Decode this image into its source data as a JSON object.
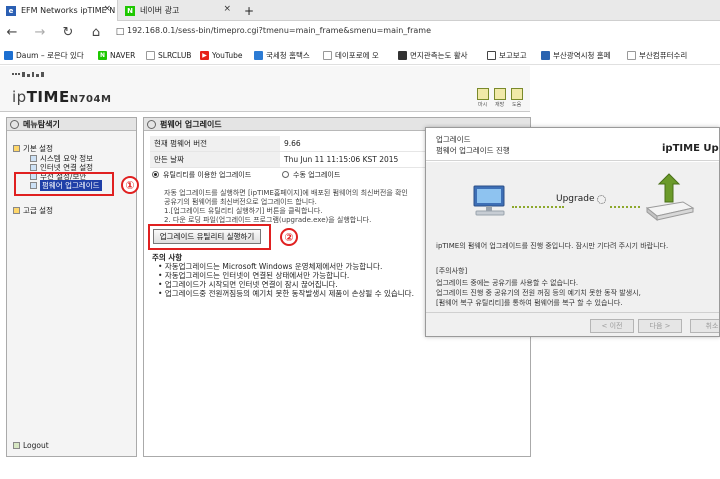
{
  "tabs": [
    {
      "title": "EFM Networks ipTIME N",
      "active": true
    },
    {
      "title": "네이버 광고",
      "active": false
    }
  ],
  "new_tab_glyph": "+",
  "address_bar": {
    "url": "192.168.0.1/sess-bin/timepro.cgi?tmenu=main_frame&smenu=main_frame"
  },
  "favorites": [
    {
      "label": "Daum – 로은다 있다",
      "icon": "daum-icon",
      "color": "#1c6fd1"
    },
    {
      "label": "NAVER",
      "icon": "naver-icon",
      "color": "#1ec800"
    },
    {
      "label": "SLRCLUB",
      "icon": "page-icon",
      "color": "#888888"
    },
    {
      "label": "YouTube",
      "icon": "youtube-icon",
      "color": "#e62117"
    },
    {
      "label": "국세청 홈택스",
      "icon": "hometax-icon",
      "color": "#2c7bd4"
    },
    {
      "label": "데이포로에 오",
      "icon": "page-icon",
      "color": "#888888"
    },
    {
      "label": "면지관측는도 활사",
      "icon": "gov-icon",
      "color": "#333333"
    },
    {
      "label": "보고보고",
      "icon": "page-icon",
      "color": "#444444"
    },
    {
      "label": "부산광역시청 홈페",
      "icon": "busan-icon",
      "color": "#2a63b0"
    },
    {
      "label": "부산컴퓨터수리",
      "icon": "page-icon",
      "color": "#888888"
    }
  ],
  "router": {
    "logo_prefix": "ip",
    "logo_brand": "TIME",
    "model": "N704M",
    "header_icons": [
      "마시",
      "재방",
      "도움"
    ],
    "left_title": "메뉴탐색기",
    "nav": {
      "basic": "기본 설정",
      "system_summary": "시스템 요약 정보",
      "internet": "인터넷 연결 설정",
      "wireless": "무선 설정/보안",
      "firmware": "펌웨어 업그레이드",
      "advanced": "고급 설정"
    },
    "logout": "Logout",
    "main_title": "펌웨어 업그레이드",
    "info": [
      {
        "k": "현재 펌웨어 버전",
        "v": "9.66"
      },
      {
        "k": "만든 날짜",
        "v": "Thu Jun 11 11:15:06 KST 2015"
      }
    ],
    "mode_auto": "유틸리티를 이용한 업그레이드",
    "mode_manual": "수동 업그레이드",
    "desc1": "자동 업그레이드를 실행하면 [ipTIME홈페이지]에 배포된 펌웨어의 최신버전을 확인",
    "desc2": "공유기의 펌웨어를 최신버전으로 업그레이드 합니다.",
    "desc3": "1.[업그레이드 유틸리티 실행하기] 버튼을 클릭합니다.",
    "desc4": "2. 다운 로딩 파일(업그레이드 프로그램(upgrade.exe)을 실행합니다.",
    "run_button": "업그레이드 유틸리티 실행하기",
    "notes_title": "주의 사항",
    "notes": [
      "자동업그레이드는 Microsoft Windows 운영체제에서만 가능합니다.",
      "자동업그레이드는 인터넷이 연결된 상태에서만 가능합니다.",
      "업그레이드가 시작되면 인터넷 연결이 잠시 끊어집니다.",
      "업그레이드중 전원꺼짐등의 예기치 못한 동작발생시 제품이 손상될 수 있습니다."
    ]
  },
  "markers": [
    "①",
    "②"
  ],
  "dialog": {
    "title": "업그레이드",
    "subtitle": "펌웨어 업그레이드 진행",
    "brand": "ipTIME Upg",
    "upgrade_label": "Upgrade",
    "status": "ipTIME의 펌웨어 업그레이드를 진행 중입니다. 잠시만 기다려 주시기 바랍니다.",
    "notice_title": "[주의사항]",
    "notice1": "업그레이드 중에는 공유기를 사용할 수 없습니다.",
    "notice2": "업그레이드 진행 중 공유기의 전원 꺼짐 등의 예기치 못한 동작 발생시,",
    "notice3": "[펌웨어 복구 유틸리티]를 통하여 펌웨어를 복구 할 수 있습니다.",
    "btn_prev": "< 이전",
    "btn_next": "다음 >",
    "btn_cancel": "취소"
  }
}
